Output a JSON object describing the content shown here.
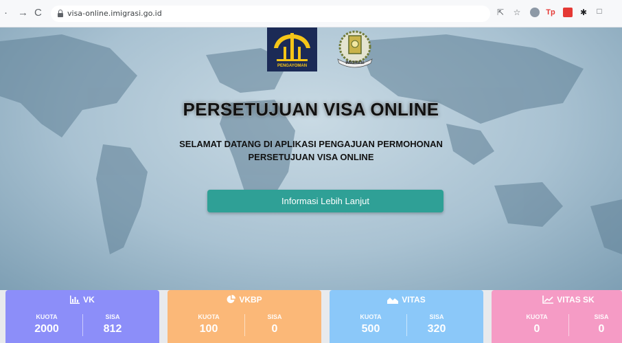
{
  "browser": {
    "url": "visa-online.imigrasi.go.id",
    "back_icon": "arrow-back-icon",
    "forward_icon": "arrow-forward-icon",
    "reload_icon": "reload-icon",
    "tp_extension": "Tp"
  },
  "hero": {
    "logo_left_caption": "PENGAYOMAN",
    "logo_right_caption": "IMIGRASI",
    "title": "PERSETUJUAN VISA ONLINE",
    "subtitle_line1": "SELAMAT DATANG DI APLIKASI PENGAJUAN PERMOHONAN",
    "subtitle_line2": "PERSETUJUAN VISA ONLINE",
    "button_label": "Informasi Lebih Lanjut",
    "button_color": "#2fa096"
  },
  "cards": [
    {
      "title": "VK",
      "icon": "bar-chart-icon",
      "color": "#8c8ef9",
      "quota_label": "KUOTA",
      "remaining_label": "SISA",
      "quota": "2000",
      "remaining": "812"
    },
    {
      "title": "VKBP",
      "icon": "pie-chart-icon",
      "color": "#fbb878",
      "quota_label": "KUOTA",
      "remaining_label": "SISA",
      "quota": "100",
      "remaining": "0"
    },
    {
      "title": "VITAS",
      "icon": "area-chart-icon",
      "color": "#8bc8f9",
      "quota_label": "KUOTA",
      "remaining_label": "SISA",
      "quota": "500",
      "remaining": "320"
    },
    {
      "title": "VITAS SK",
      "icon": "line-chart-icon",
      "color": "#f59bc5",
      "quota_label": "KUOTA",
      "remaining_label": "SISA",
      "quota": "0",
      "remaining": "0"
    }
  ]
}
